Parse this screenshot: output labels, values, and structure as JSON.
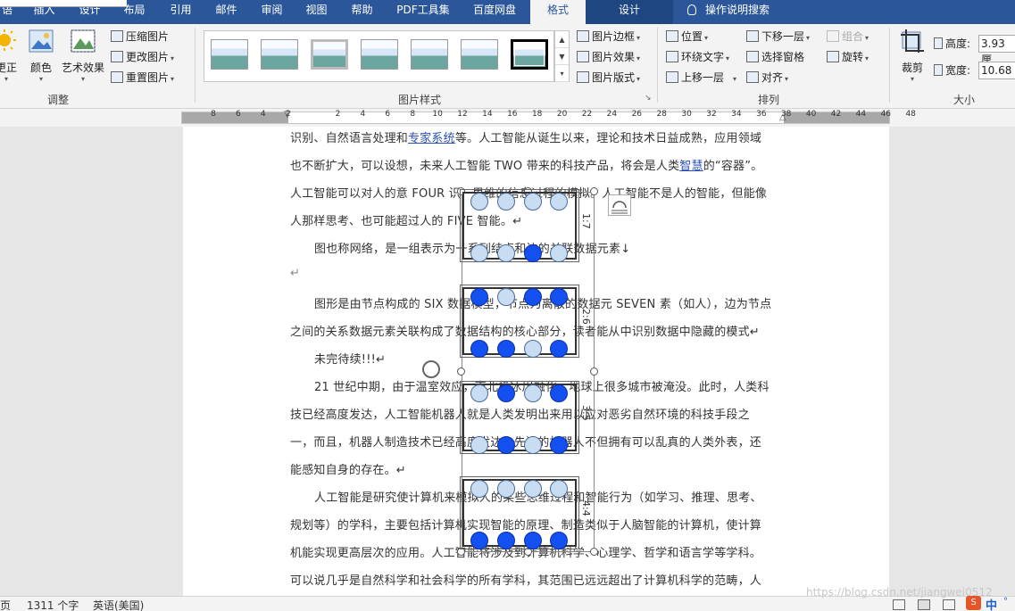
{
  "tabs": [
    {
      "label": "插入",
      "active": false
    },
    {
      "label": "设计",
      "active": false
    },
    {
      "label": "布局",
      "active": false
    },
    {
      "label": "引用",
      "active": false
    },
    {
      "label": "邮件",
      "active": false
    },
    {
      "label": "审阅",
      "active": false
    },
    {
      "label": "视图",
      "active": false
    },
    {
      "label": "帮助",
      "active": false
    },
    {
      "label": "PDF工具集",
      "active": false
    },
    {
      "label": "百度网盘",
      "active": false
    },
    {
      "label": "格式",
      "active": true
    },
    {
      "label": "设计",
      "active": false
    }
  ],
  "tab_partial": "语",
  "search_label": "操作说明搜索",
  "ribbon": {
    "adjust": {
      "correct": "更正",
      "color": "颜色",
      "art": "艺术效果",
      "compress": "压缩图片",
      "change": "更改图片",
      "reset": "重置图片",
      "group_label": "调整"
    },
    "styles": {
      "group_label": "图片样式",
      "border": "图片边框",
      "effect": "图片效果",
      "layout": "图片版式"
    },
    "arrange": {
      "group_label": "排列",
      "position": "位置",
      "wrap": "环绕文字",
      "forward": "上移一层",
      "backward": "下移一层",
      "pane": "选择窗格",
      "align": "对齐",
      "group": "组合",
      "rotate": "旋转"
    },
    "size": {
      "group_label": "大小",
      "crop": "裁剪",
      "height_label": "高度:",
      "height_value": "3.93 厘",
      "width_label": "宽度:",
      "width_value": "10.68"
    }
  },
  "ruler_numbers": [
    "8",
    "6",
    "4",
    "2",
    "",
    "2",
    "4",
    "6",
    "8",
    "10",
    "12",
    "14",
    "16",
    "18",
    "20",
    "22",
    "24",
    "26",
    "28",
    "30",
    "32",
    "34",
    "36",
    "38",
    "40",
    "42",
    "44",
    "46",
    "48"
  ],
  "doc": {
    "l1_a": "识别、自然语言处理和",
    "l1_link": "专家系统",
    "l1_b": "等。人工智能从诞生以来，理论和技术日益成熟，应用领域",
    "l2_a": "也不断扩大，可以设想，未来人工智能 TWO 带来的科技产品，将会是人类",
    "l2_link": "智慧",
    "l2_b": "的“容器”。",
    "l3": "人工智能可以对人的意 FOUR 识、思维的信息过程的模拟。人工智能不是人的智能，但能像",
    "l4": "人那样思考、也可能超过人的 FIVE 智能。↵",
    "l5": "图也称网络，是一组表示为一系列结点和边的关联数据元素↓",
    "l6": "↵",
    "l7": "图形是由节点构成的 SIX 数据模型，节点为离散的数据元 SEVEN 素（如人），边为节点",
    "l8": "之间的关系数据元素关联构成了数据结构的核心部分，读者能从中识别数据中隐藏的模式↵",
    "l9": "未完待续!!!↵",
    "l10": "21 世纪中期，由于温室效应，南北极冰川融化，地球上很多城市被淹没。此时，人类科",
    "l11": "技已经高度发达，人工智能机器人就是人类发明出来用以应对恶劣自然环境的科技手段之",
    "l12": "一，而且，机器人制造技术已经高度发达，先进的机器人不但拥有可以乱真的人类外表，还",
    "l13": "能感知自身的存在。↵",
    "l14": "人工智能是研究使计算机来模拟人的某些思维过程和智能行为（如学习、推理、思考、",
    "l15": "规划等）的学科，主要包括计算机实现智能的原理、制造类似于人脑智能的计算机，使计算",
    "l16": "机能实现更高层次的应用。人工智能将涉及到计算机科学、心理学、哲学和语言学等学科。",
    "l17": "可以说几乎是自然科学和社会科学的所有学科，其范围已远远超出了计算机科学的范畴，人"
  },
  "panels": [
    {
      "ratio": "1:7",
      "top": [
        "light",
        "light",
        "light",
        "light"
      ],
      "bottom": [
        "light",
        "light",
        "dark",
        "light"
      ]
    },
    {
      "ratio": "2:6",
      "top": [
        "dark",
        "light",
        "dark",
        "dark"
      ],
      "bottom": [
        "dark",
        "dark",
        "light",
        "dark"
      ]
    },
    {
      "ratio": "3:5",
      "top": [
        "light",
        "dark",
        "light",
        "dark"
      ],
      "bottom": [
        "light",
        "dark",
        "light",
        "dark"
      ]
    },
    {
      "ratio": "4:4",
      "top": [
        "light",
        "light",
        "light",
        "light"
      ],
      "bottom": [
        "dark",
        "dark",
        "dark",
        "dark"
      ]
    }
  ],
  "status": {
    "page": "页",
    "words": "1311 个字",
    "lang": "英语(美国)"
  },
  "watermark": "https://blog.csdn.net/jiangwei0512",
  "ime_label": "中"
}
